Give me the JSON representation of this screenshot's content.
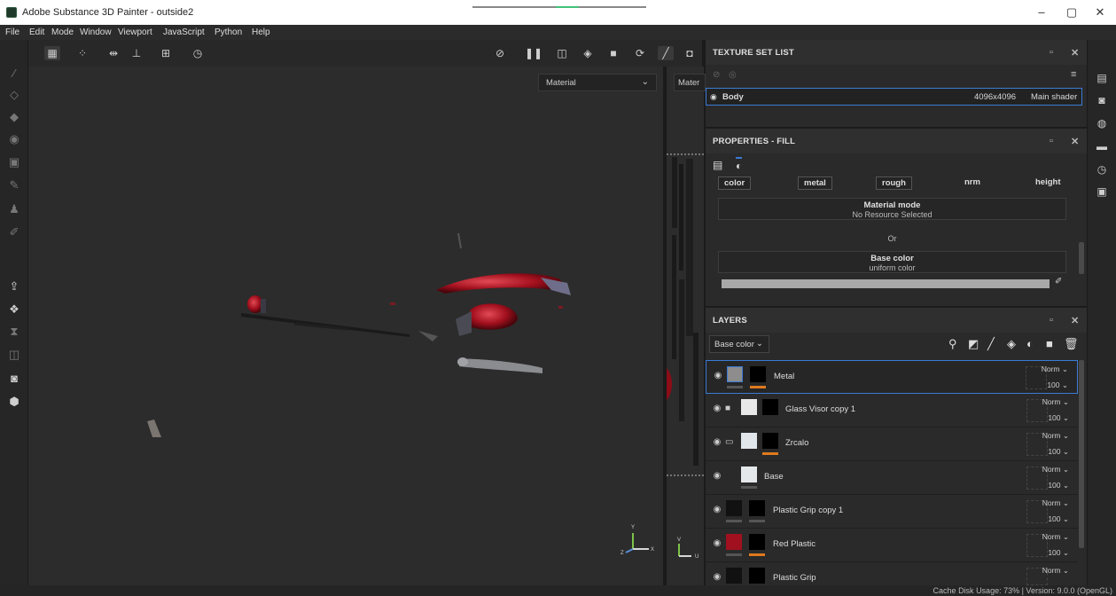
{
  "window": {
    "title": "Adobe Substance 3D Painter - outside2",
    "controls": [
      "–",
      "▢",
      "✕"
    ]
  },
  "menu": [
    "File",
    "Edit",
    "Mode",
    "Window",
    "Viewport",
    "JavaScript",
    "Python",
    "Help"
  ],
  "viewport": {
    "left_mode": "Material",
    "right_mode": "Mater"
  },
  "texture_set_list": {
    "title": "TEXTURE SET LIST",
    "set": {
      "name": "Body",
      "resolution": "4096x4096",
      "shader": "Main shader"
    }
  },
  "properties": {
    "title": "PROPERTIES - FILL",
    "channels": [
      "color",
      "metal",
      "rough",
      "nrm",
      "height"
    ],
    "material_mode": {
      "label": "Material mode",
      "value": "No Resource Selected"
    },
    "or_label": "Or",
    "base_color": {
      "label": "Base color",
      "value": "uniform color"
    }
  },
  "layers": {
    "title": "LAYERS",
    "channel_select": "Base color",
    "items": [
      {
        "name": "Metal",
        "blend": "Norm",
        "opacity": "100"
      },
      {
        "name": "Glass Visor copy 1",
        "blend": "Norm",
        "opacity": "100"
      },
      {
        "name": "Zrcalo",
        "blend": "Norm",
        "opacity": "100"
      },
      {
        "name": "Base",
        "blend": "Norm",
        "opacity": "100"
      },
      {
        "name": "Plastic Grip copy 1",
        "blend": "Norm",
        "opacity": "100"
      },
      {
        "name": "Red Plastic",
        "blend": "Norm",
        "opacity": "100"
      },
      {
        "name": "Plastic Grip",
        "blend": "Norm",
        "opacity": ""
      }
    ]
  },
  "axis_labels": {
    "y": "Y",
    "x": "X",
    "z": "Z",
    "u": "U",
    "v": "V"
  },
  "status": "Cache Disk Usage:  73% | Version: 9.0.0 (OpenGL)"
}
